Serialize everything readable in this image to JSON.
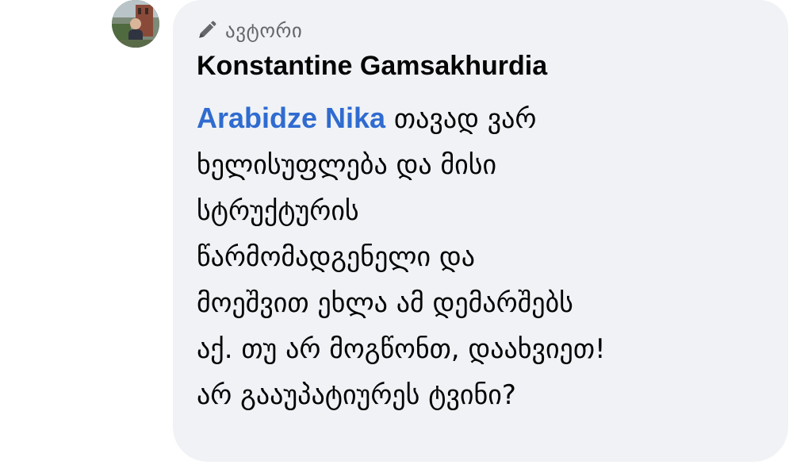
{
  "badge": {
    "icon": "pencil-icon",
    "label": "ავტორი"
  },
  "author": {
    "name": "Konstantine Gamsakhurdia"
  },
  "comment": {
    "mention": "Arabidze Nika",
    "lines": [
      "თავად ვარ",
      "ხელისუფლება და მისი",
      "სტრუქტურის",
      "წარმომადგენელი და",
      "მოეშვით ეხლა ამ დემარშებს",
      "აქ. თუ არ მოგწონთ, დაახვიეთ!",
      "არ გააუპატიურეს ტვინი?"
    ]
  },
  "colors": {
    "bubble": "#f0f2f5",
    "mention": "#2f6bd0",
    "text": "#050505",
    "muted": "#65676b"
  }
}
